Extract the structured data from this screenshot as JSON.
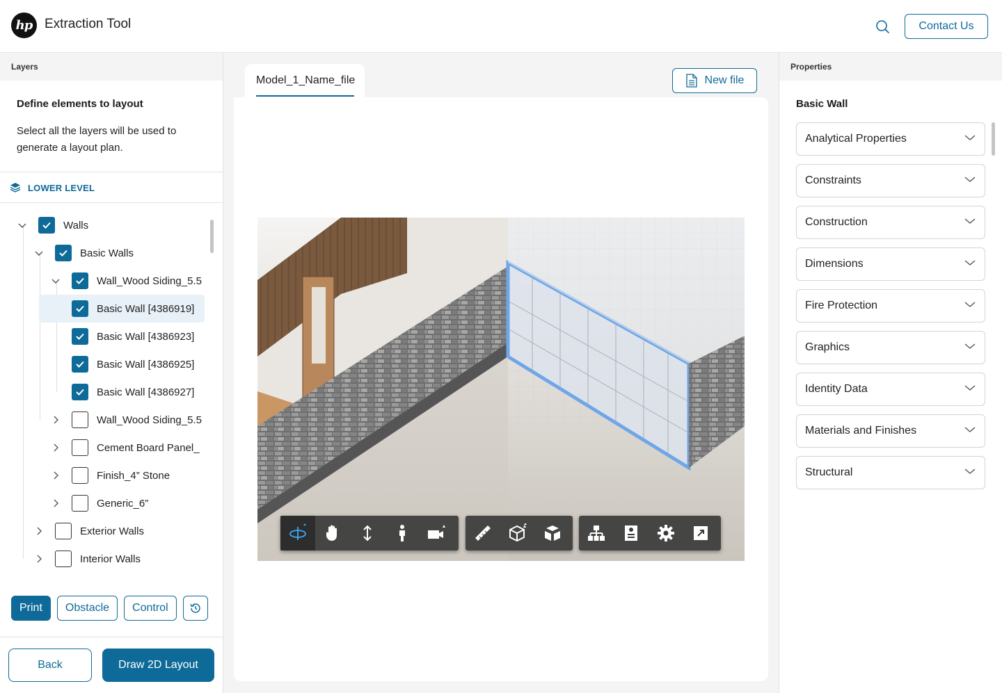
{
  "header": {
    "logo_text": "hp",
    "app_title": "Extraction Tool",
    "contact_label": "Contact Us"
  },
  "left_panel": {
    "title": "Layers",
    "define_title": "Define elements to layout",
    "define_desc": "Select all the layers will be used to generate a layout plan.",
    "level_label": "LOWER LEVEL",
    "tree": [
      {
        "label": "Walls",
        "checked": true,
        "expanded": true,
        "depth": 0
      },
      {
        "label": "Basic Walls",
        "checked": true,
        "expanded": true,
        "depth": 1
      },
      {
        "label": "Wall_Wood Siding_5.5",
        "checked": true,
        "expanded": true,
        "depth": 2
      },
      {
        "label": "Basic Wall [4386919]",
        "checked": true,
        "depth": 3,
        "selected": true
      },
      {
        "label": "Basic Wall [4386923]",
        "checked": true,
        "depth": 3
      },
      {
        "label": "Basic Wall [4386925]",
        "checked": true,
        "depth": 3
      },
      {
        "label": "Basic Wall [4386927]",
        "checked": true,
        "depth": 3
      },
      {
        "label": "Wall_Wood Siding_5.5",
        "checked": false,
        "expanded": false,
        "depth": 2
      },
      {
        "label": "Cement Board Panel_",
        "checked": false,
        "expanded": false,
        "depth": 2
      },
      {
        "label": "Finish_4” Stone",
        "checked": false,
        "expanded": false,
        "depth": 2
      },
      {
        "label": "Generic_6”",
        "checked": false,
        "expanded": false,
        "depth": 2
      },
      {
        "label": "Exterior Walls",
        "checked": false,
        "expanded": false,
        "depth": 1
      },
      {
        "label": "Interior Walls",
        "checked": false,
        "expanded": false,
        "depth": 1
      }
    ],
    "actions": {
      "print": "Print",
      "obstacle": "Obstacle",
      "control": "Control"
    },
    "back_label": "Back",
    "draw_label": "Draw 2D Layout"
  },
  "center": {
    "tab_label": "Model_1_Name_file",
    "new_file_label": "New file",
    "toolbar_groups": [
      [
        "orbit-icon",
        "pan-hand-icon",
        "zoom-vertical-icon",
        "first-person-icon",
        "camera-icon"
      ],
      [
        "measure-ruler-icon",
        "section-box-icon",
        "explode-cube-icon"
      ],
      [
        "model-browser-icon",
        "properties-panel-icon",
        "settings-gear-icon",
        "fullscreen-icon"
      ]
    ]
  },
  "right_panel": {
    "title": "Properties",
    "element_title": "Basic Wall",
    "sections": [
      "Analytical Properties",
      "Constraints",
      "Construction",
      "Dimensions",
      "Fire Protection",
      "Graphics",
      "Identity Data",
      "Materials and Finishes",
      "Structural"
    ]
  },
  "colors": {
    "primary": "#0e6a98",
    "selection": "#e8f1f8",
    "panel_header": "#f4f4f4"
  }
}
